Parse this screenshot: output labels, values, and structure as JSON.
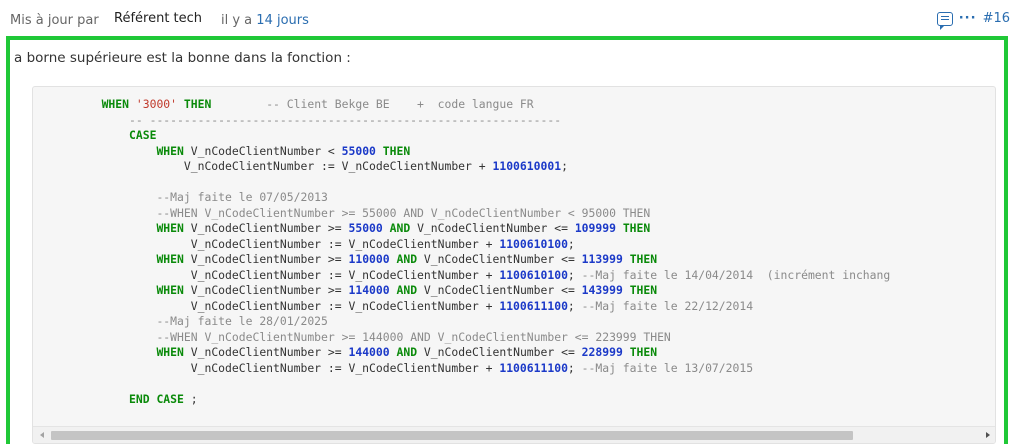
{
  "header": {
    "updated_by_label": "Mis à jour par",
    "author": "Référent tech",
    "ago_prefix": "il y a",
    "ago_link": "14 jours",
    "note_number": "#16",
    "more_label": "···"
  },
  "note": {
    "intro": "a borne supérieure est la bonne dans la fonction :"
  },
  "code": {
    "l1_when": "WHEN",
    "l1_str": "'3000'",
    "l1_then": "THEN",
    "l1_comment": "        -- Client Bekge BE    +  code langue FR",
    "l2_comment": "-- ------------------------------------------------------------",
    "l3_case": "CASE",
    "l4_when": "WHEN",
    "l4_mid": " V_nCodeClientNumber < ",
    "l4_num": "55000",
    "l4_then": "THEN",
    "l5_text": "V_nCodeClientNumber := V_nCodeClientNumber + ",
    "l5_num": "1100610001",
    "l5_end": ";",
    "l7_comment": "--Maj faite le 07/05/2013",
    "l8_comment": "--WHEN V_nCodeClientNumber >= 55000 AND V_nCodeClientNumber < 95000 THEN",
    "l9_when": "WHEN",
    "l9_a": " V_nCodeClientNumber >= ",
    "l9_n1": "55000",
    "l9_and": "AND",
    "l9_b": " V_nCodeClientNumber <= ",
    "l9_n2": "109999",
    "l9_then": "THEN",
    "l10_text": "V_nCodeClientNumber := V_nCodeClientNumber + ",
    "l10_num": "1100610100",
    "l10_end": ";",
    "l11_when": "WHEN",
    "l11_a": " V_nCodeClientNumber >= ",
    "l11_n1": "110000",
    "l11_and": "AND",
    "l11_b": " V_nCodeClientNumber <= ",
    "l11_n2": "113999",
    "l11_then": "THEN",
    "l12_text": "V_nCodeClientNumber := V_nCodeClientNumber + ",
    "l12_num": "1100610100",
    "l12_end": ";",
    "l12_comment": " --Maj faite le 14/04/2014  (incrément inchang",
    "l13_when": "WHEN",
    "l13_a": " V_nCodeClientNumber >= ",
    "l13_n1": "114000",
    "l13_and": "AND",
    "l13_b": " V_nCodeClientNumber <= ",
    "l13_n2": "143999",
    "l13_then": "THEN",
    "l14_text": "V_nCodeClientNumber := V_nCodeClientNumber + ",
    "l14_num": "1100611100",
    "l14_end": ";",
    "l14_comment": " --Maj faite le 22/12/2014",
    "l15_comment": "--Maj faite le 28/01/2025",
    "l16_comment": "--WHEN V_nCodeClientNumber >= 144000 AND V_nCodeClientNumber <= 223999 THEN",
    "l17_when": "WHEN",
    "l17_a": " V_nCodeClientNumber >= ",
    "l17_n1": "144000",
    "l17_and": "AND",
    "l17_b": " V_nCodeClientNumber <= ",
    "l17_n2": "228999",
    "l17_then": "THEN",
    "l18_text": "V_nCodeClientNumber := V_nCodeClientNumber + ",
    "l18_num": "1100611100",
    "l18_end": ";",
    "l18_comment": " --Maj faite le 13/07/2015",
    "l20_end": "END CASE",
    "l20_semi": " ;"
  },
  "scrollbar": {
    "position_fraction": 0.0,
    "visible_fraction": 0.85
  },
  "colors": {
    "highlight_border": "#20c837",
    "link": "#2a6db0",
    "keyword": "#0a8a0a",
    "number": "#1b39c8",
    "string": "#c0392b",
    "comment": "#8a8a8a"
  }
}
